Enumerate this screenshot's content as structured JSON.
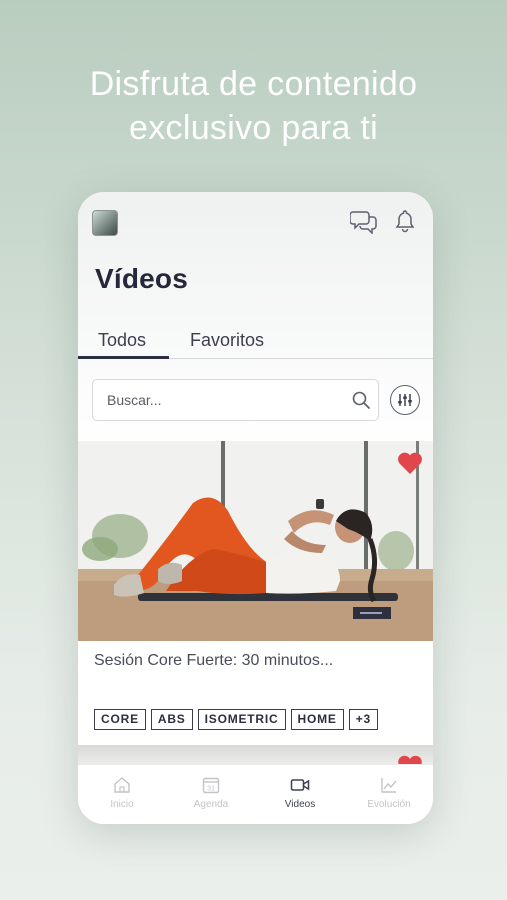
{
  "headline": {
    "line1": "Disfruta de contenido",
    "line2": "exclusivo para ti"
  },
  "header": {
    "logo_icon": "app-logo-icon",
    "chat_icon": "chat-bubbles-icon",
    "notification_icon": "bell-icon"
  },
  "page": {
    "title": "Vídeos"
  },
  "tabs": [
    {
      "label": "Todos",
      "active": true
    },
    {
      "label": "Favoritos",
      "active": false
    }
  ],
  "search": {
    "placeholder": "Buscar...",
    "value": "",
    "icon": "search-icon"
  },
  "filter": {
    "icon": "sliders-icon"
  },
  "video_card": {
    "title": "Sesión Core Fuerte: 30 minutos...",
    "favorited": true,
    "favorite_color": "#e0464a",
    "tags": [
      "CORE",
      "ABS",
      "ISOMETRIC",
      "HOME",
      "+3"
    ]
  },
  "bottom_nav": [
    {
      "label": "Inicio",
      "icon": "home-icon",
      "active": false
    },
    {
      "label": "Agenda",
      "icon": "calendar-icon",
      "calendar_day": "31",
      "active": false
    },
    {
      "label": "Videos",
      "icon": "video-camera-icon",
      "active": true
    },
    {
      "label": "Evolución",
      "icon": "chart-icon",
      "active": false
    }
  ],
  "colors": {
    "accent": "#2b2f45",
    "heart": "#e0464a",
    "nav_inactive": "#c4c4c8",
    "background_top": "#b9cdbf"
  }
}
